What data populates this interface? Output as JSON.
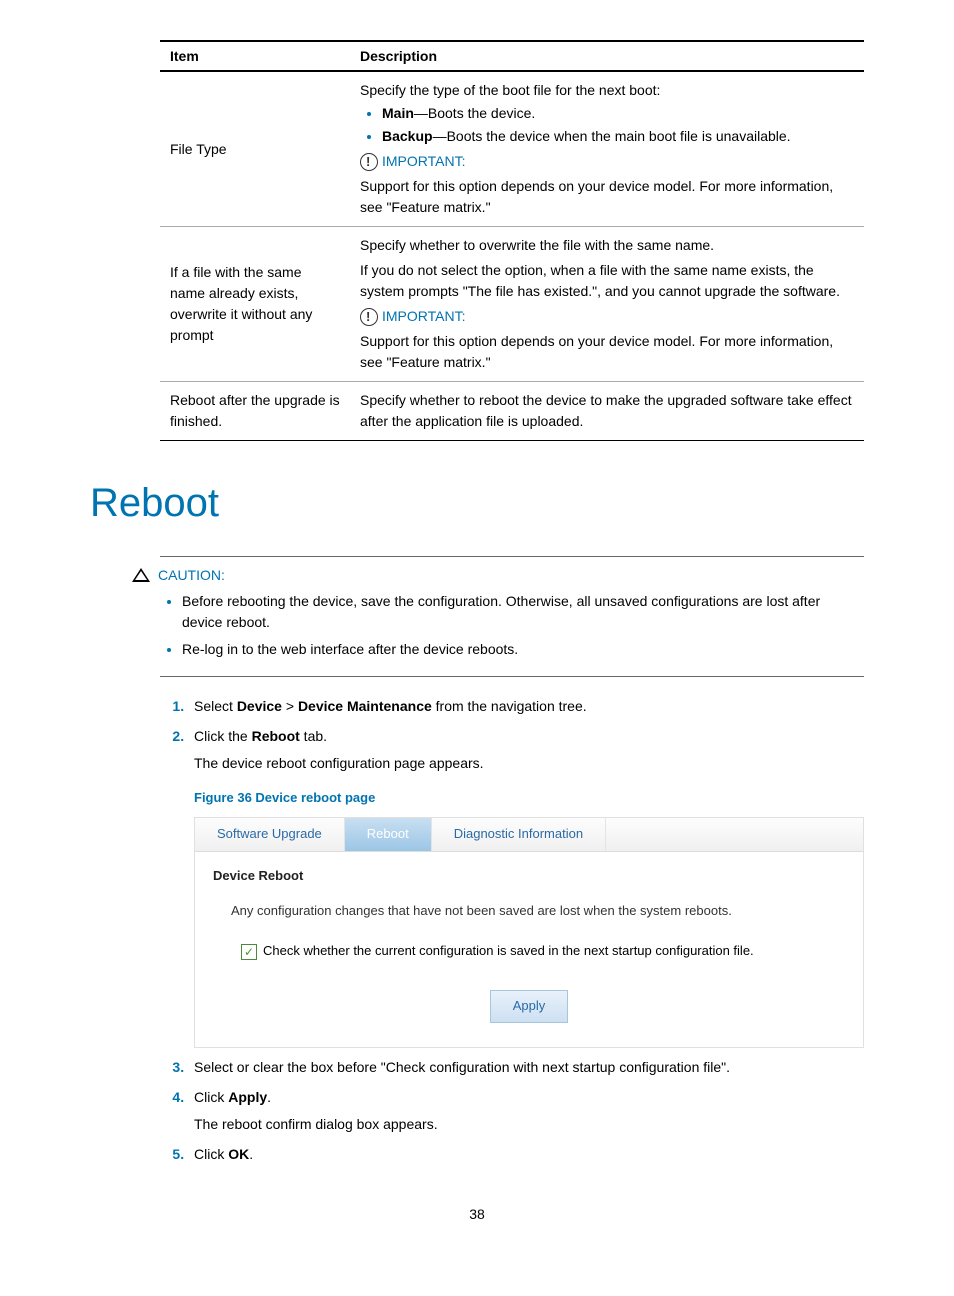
{
  "table": {
    "headers": {
      "item": "Item",
      "desc": "Description"
    },
    "row1": {
      "item": "File Type",
      "intro": "Specify the type of the boot file for the next boot:",
      "b1_bold": "Main",
      "b1_rest": "—Boots the device.",
      "b2_bold": "Backup",
      "b2_rest": "—Boots the device when the main boot file is unavailable.",
      "important": "IMPORTANT:",
      "support": "Support for this option depends on your device model. For more information, see \"Feature matrix.\""
    },
    "row2": {
      "item": "If a file with the same name already exists, overwrite it without any prompt",
      "p1": "Specify whether to overwrite the file with the same name.",
      "p2": "If you do not select the option, when a file with the same name exists, the system prompts \"The file has existed.\", and you cannot upgrade the software.",
      "important": "IMPORTANT:",
      "support": "Support for this option depends on your device model. For more information, see \"Feature matrix.\""
    },
    "row3": {
      "item": "Reboot after the upgrade is finished.",
      "desc": "Specify whether to reboot the device to make the upgraded software take effect after the application file is uploaded."
    }
  },
  "section_title": "Reboot",
  "caution": {
    "label": "CAUTION:",
    "c1": "Before rebooting the device, save the configuration. Otherwise, all unsaved configurations are lost after device reboot.",
    "c2": "Re-log in to the web interface after the device reboots."
  },
  "steps": {
    "s1_a": "Select ",
    "s1_b1": "Device",
    "s1_gt": " > ",
    "s1_b2": "Device Maintenance",
    "s1_c": " from the navigation tree.",
    "s2_a": "Click the ",
    "s2_b": "Reboot",
    "s2_c": " tab.",
    "s2_sub": "The device reboot configuration page appears.",
    "s3": "Select or clear the box before \"Check configuration with next startup configuration file\".",
    "s4_a": "Click ",
    "s4_b": "Apply",
    "s4_c": ".",
    "s4_sub": "The reboot confirm dialog box appears.",
    "s5_a": "Click ",
    "s5_b": "OK",
    "s5_c": "."
  },
  "figure": {
    "caption": "Figure 36 Device reboot page",
    "tab1": "Software Upgrade",
    "tab2": "Reboot",
    "tab3": "Diagnostic Information",
    "heading": "Device Reboot",
    "note": "Any configuration changes that have not been saved are lost when the system reboots.",
    "check_label": "Check whether the current configuration is saved in the next startup configuration file.",
    "apply": "Apply"
  },
  "page_number": "38"
}
